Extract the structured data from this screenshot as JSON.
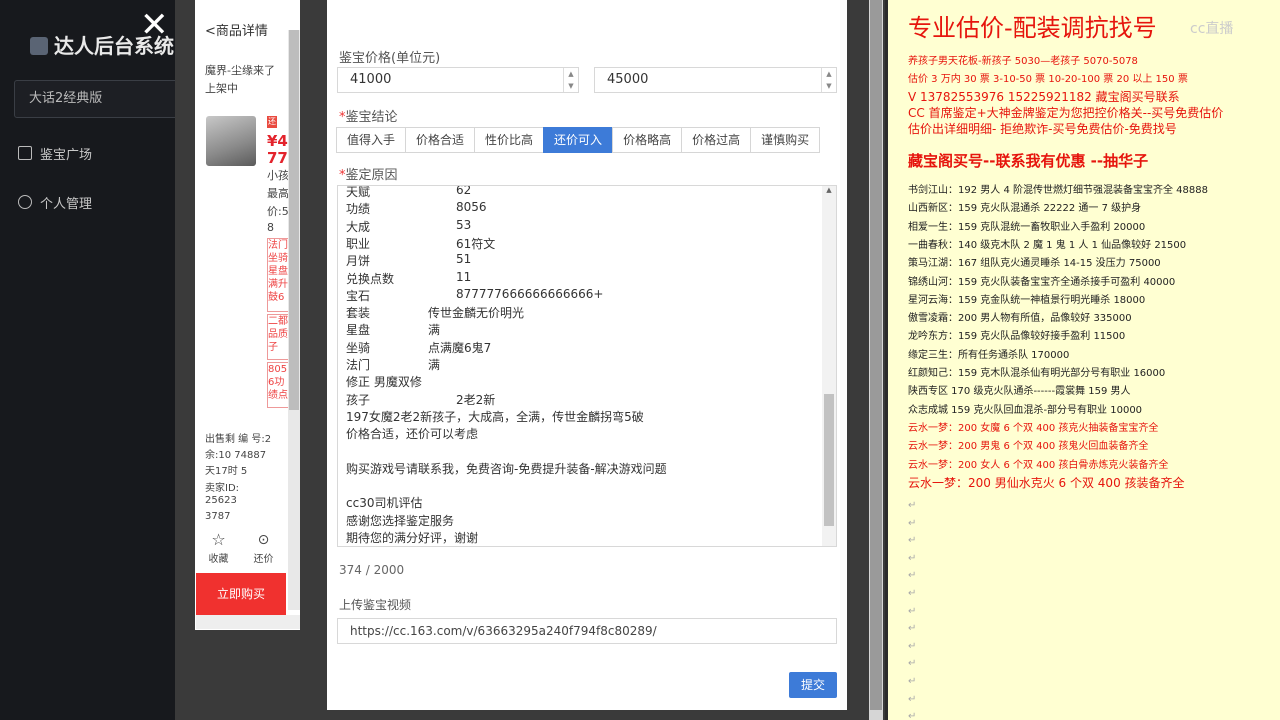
{
  "sidebar": {
    "logo": "达人后台系统",
    "select_value": "大话2经典版",
    "items": [
      {
        "label": "鉴宝广场",
        "icon": "book-icon"
      },
      {
        "label": "个人管理",
        "icon": "user-icon"
      }
    ]
  },
  "mini_panel": {
    "top_label": "<商品详情",
    "seller": "魔界-尘缘来了",
    "status": "上架中",
    "price": "¥4",
    "price2": "77",
    "tag": "还",
    "desc1": "小孩",
    "desc2": "最高",
    "desc3": "价:5",
    "desc4": "8",
    "red_tags": [
      "法门坐骑星盘满升鼓6",
      "二都品质子",
      "805 6功绩点"
    ],
    "meta": [
      "出售剩 编 号:2",
      "余:10  74887",
      "天17时  5",
      "卖家ID:",
      "25623",
      "3787"
    ],
    "fav": "收藏",
    "bargain": "还价",
    "buy": "立即购买"
  },
  "form": {
    "price_label": "鉴宝价格(单位元)",
    "price_low": "41000",
    "price_high": "45000",
    "result_label": "鉴宝结论",
    "tabs": [
      "值得入手",
      "价格合适",
      "性价比高",
      "还价可入",
      "价格略高",
      "价格过高",
      "谨慎购买"
    ],
    "active_tab": "还价可入",
    "reason_label": "鉴定原因",
    "reason_lines": [
      {
        "k": "天赋",
        "v": "62"
      },
      {
        "k": "功绩",
        "v": "8056"
      },
      {
        "k": "大成",
        "v": "53"
      },
      {
        "k": "职业",
        "v": "61符文"
      },
      {
        "k": "月饼",
        "v": "51"
      },
      {
        "k": "兑换点数",
        "v": "11"
      },
      {
        "k": "宝石",
        "v": "877777666666666666+"
      },
      {
        "k": "套装",
        "v": "传世金麟无价明光"
      },
      {
        "k": "星盘",
        "v": "满"
      },
      {
        "k": "坐骑",
        "v": "点满魔6鬼7"
      },
      {
        "k": "法门",
        "v": "满"
      },
      {
        "k": "修正 男魔双修",
        "v": ""
      },
      {
        "k": "孩子",
        "v": "2老2新"
      },
      {
        "k": "197女魔2老2新孩子，大成高，全满，传世金麟拐弯5破",
        "v": ""
      },
      {
        "k": "价格合适，还价可以考虑",
        "v": ""
      },
      {
        "k": "",
        "v": ""
      },
      {
        "k": "购买游戏号请联系我，免费咨询-免费提升装备-解决游戏问题",
        "v": ""
      },
      {
        "k": "",
        "v": ""
      },
      {
        "k": "cc30司机评估",
        "v": ""
      },
      {
        "k": "感谢您选择鉴定服务",
        "v": ""
      },
      {
        "k": "期待您的满分好评，谢谢",
        "v": ""
      }
    ],
    "counter": "374 / 2000",
    "video_label": "上传鉴宝视频",
    "video_url": "https://cc.163.com/v/63663295a240f794f8c80289/",
    "submit": "提交"
  },
  "doc": {
    "title": "专业估价-配装调抗找号",
    "watermark": "cc直播",
    "header_lines": [
      "养孩子男天花板-新孩子 5030—老孩子 5070-5078",
      "估价 3 万内 30 票    3-10-50 票    10-20-100 票    20 以上 150 票",
      "V  13782553976     15225921182    藏宝阁买号联系",
      "CC 首席鉴定+大神金牌鉴定为您把控价格关--买号免费估价",
      "估价出详细明细- 拒绝欺诈-买号免费估价-免费找号"
    ],
    "highlight": "藏宝阁买号--联系我有优惠 --抽华子",
    "listings": [
      {
        "text": "书剑江山：192 男人 4 阶混传世燃灯细节强混装备宝宝齐全 48888",
        "color": "black"
      },
      {
        "text": "山西新区：159 克火队混通杀 22222 通一 7 级护身",
        "color": "black"
      },
      {
        "text": "相爱一生：159 克队混统一畜牧职业入手盈利 20000",
        "color": "black"
      },
      {
        "text": "一曲春秋：140 级克木队 2 魔 1 鬼 1 人 1 仙品像较好 21500",
        "color": "black"
      },
      {
        "text": "策马江湖：167 组队克火通灵睡杀 14-15 没压力 75000",
        "color": "black"
      },
      {
        "text": "锦绣山河：159 克火队装备宝宝齐全通杀接手可盈利 40000",
        "color": "black"
      },
      {
        "text": "星河云海：159 克金队统一神植景行明光睡杀 18000",
        "color": "black"
      },
      {
        "text": "傲雪凌霜：200 男人物有所值，品像较好 335000",
        "color": "black"
      },
      {
        "text": "龙吟东方：159 克火队品像较好接手盈利 11500",
        "color": "black"
      },
      {
        "text": "缘定三生：所有任务通杀队 170000",
        "color": "black"
      },
      {
        "text": "红颜知己：159 克木队混杀仙有明光部分号有职业 16000",
        "color": "black"
      },
      {
        "text": "陕西专区 170 级克火队通杀------霞裳舞 159 男人",
        "color": "black"
      },
      {
        "text": "众志成城 159 克火队回血混杀-部分号有职业 10000",
        "color": "black"
      },
      {
        "text": "云水一梦：200 女魔 6 个双 400 孩克火抽装备宝宝齐全",
        "color": "red"
      },
      {
        "text": "云水一梦：200 男鬼 6 个双 400 孩鬼火回血装备齐全",
        "color": "red"
      },
      {
        "text": "云水一梦：200 女人 6 个双 400 孩白骨赤炼克火装备齐全",
        "color": "red"
      },
      {
        "text": "云水一梦：200 男仙水克火 6 个双 400 孩装备齐全",
        "color": "red"
      }
    ],
    "return_mark": "↵"
  }
}
